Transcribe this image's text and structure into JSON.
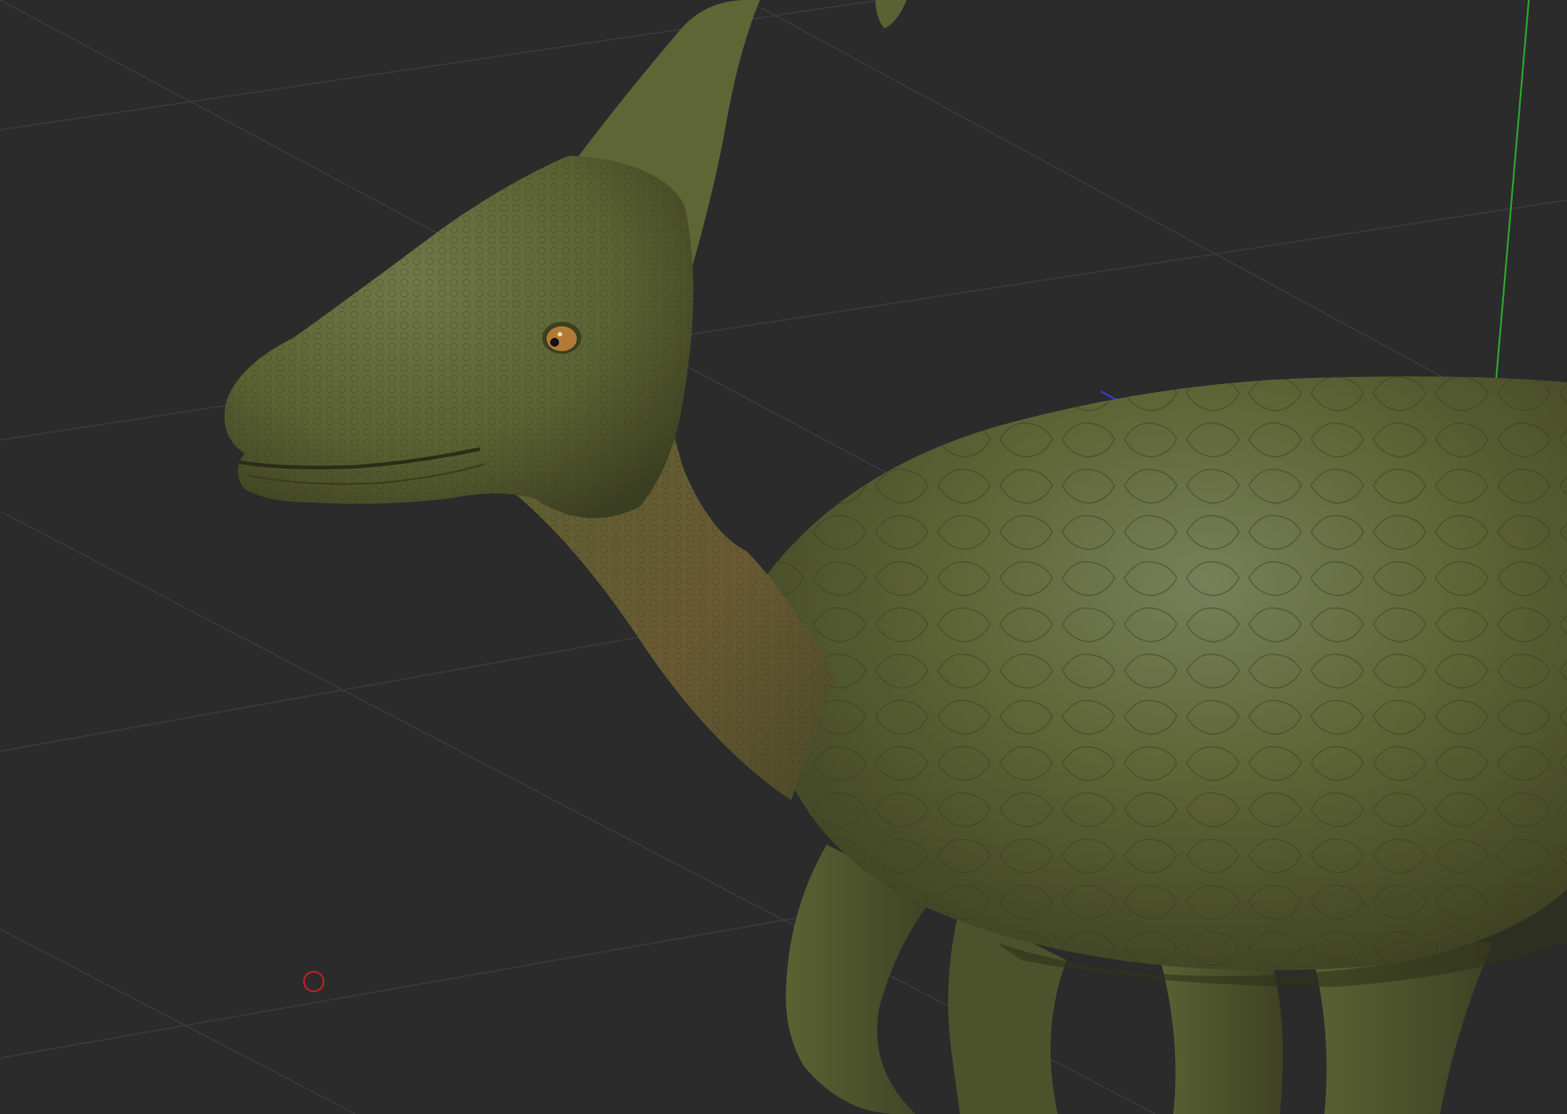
{
  "viewport": {
    "background_color": "#2b2b2c",
    "grid_line_color": "#3b3b3d",
    "axis_colors": {
      "y_axis": "#2ea32e",
      "x_axis_hint": "#3a3ad0",
      "origin_marker": "#c02020"
    },
    "model": {
      "subject": "parasaurolophus-dinosaur",
      "skin_colors": {
        "base": "#5d6433",
        "highlight": "#77805a",
        "shadow": "#3d4122",
        "brown_tint": "#6a5530",
        "eye": "#b37a35"
      }
    }
  }
}
